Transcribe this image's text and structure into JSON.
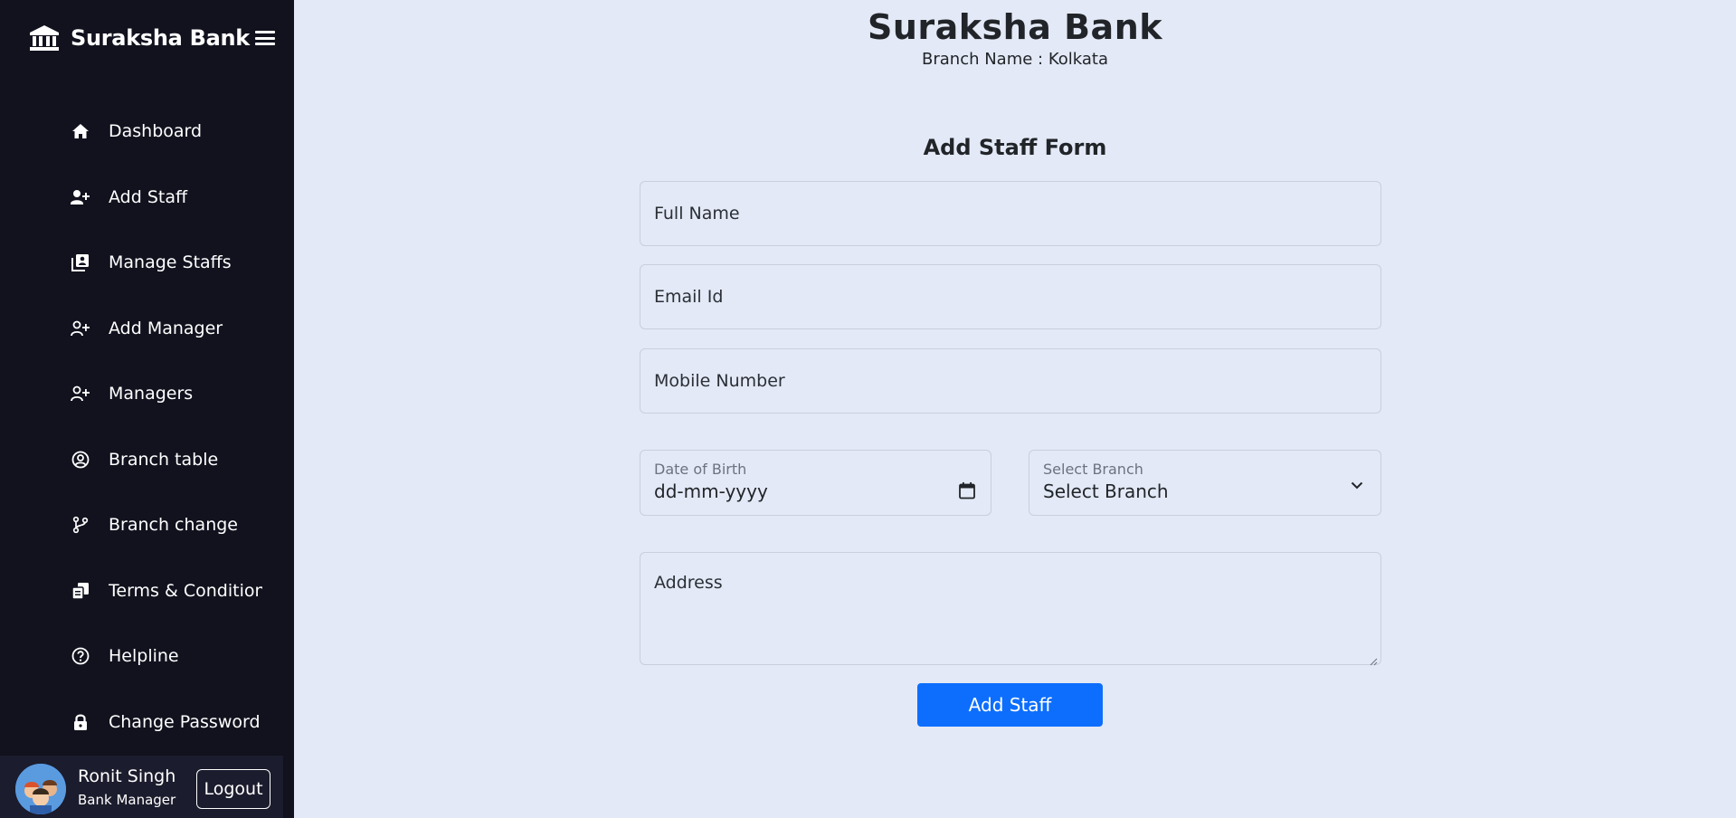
{
  "sidebar": {
    "brand": "Suraksha Bank",
    "items": [
      {
        "label": "Dashboard",
        "icon": "home-icon"
      },
      {
        "label": "Add Staff",
        "icon": "person-plus-icon"
      },
      {
        "label": "Manage Staffs",
        "icon": "staff-list-icon"
      },
      {
        "label": "Add Manager",
        "icon": "person-plus-outline-icon"
      },
      {
        "label": "Managers",
        "icon": "person-plus-outline-icon"
      },
      {
        "label": "Branch table",
        "icon": "person-circle-icon"
      },
      {
        "label": "Branch change",
        "icon": "git-branch-icon"
      },
      {
        "label": "Terms & Conditions",
        "icon": "documents-icon"
      },
      {
        "label": "Helpline",
        "icon": "question-circle-icon"
      },
      {
        "label": "Change Password",
        "icon": "lock-icon"
      }
    ],
    "user": {
      "name": "Ronit Singh",
      "role": "Bank Manager",
      "logout_label": "Logout"
    }
  },
  "header": {
    "title": "Suraksha Bank",
    "branch": "Branch Name : Kolkata"
  },
  "form": {
    "title": "Add Staff Form",
    "full_name_placeholder": "Full Name",
    "email_placeholder": "Email Id",
    "mobile_placeholder": "Mobile Number",
    "dob_label": "Date of Birth",
    "dob_value": "dd-mm-yyyy",
    "branch_label": "Select Branch",
    "branch_value": "Select Branch",
    "address_placeholder": "Address",
    "submit_label": "Add Staff"
  },
  "colors": {
    "sidebar_bg": "#11121e",
    "page_bg": "#e3e9f6",
    "primary": "#0d6efd"
  }
}
